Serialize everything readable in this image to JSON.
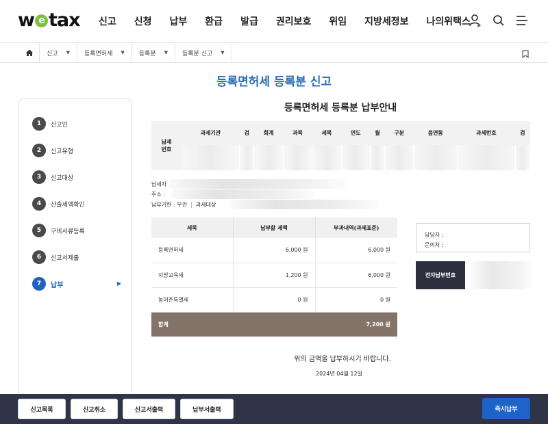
{
  "header": {
    "logo_left": "w",
    "logo_e": "e",
    "logo_right": "tax",
    "nav": [
      "신고",
      "신청",
      "납부",
      "환급",
      "발급",
      "권리보호",
      "위임",
      "지방세정보",
      "나의위택스"
    ],
    "icons": [
      "user-icon",
      "search-icon",
      "menu-icon"
    ],
    "my_label": "MY"
  },
  "breadcrumb": {
    "items": [
      "신고",
      "등록면허세",
      "등록분",
      "등록분 신고"
    ]
  },
  "page_title": "등록면허세 등록분 신고",
  "steps": [
    {
      "num": "1",
      "label": "신고인"
    },
    {
      "num": "2",
      "label": "신고유형"
    },
    {
      "num": "3",
      "label": "신고대상"
    },
    {
      "num": "4",
      "label": "산출세액확인"
    },
    {
      "num": "5",
      "label": "구비서류등록"
    },
    {
      "num": "6",
      "label": "신고서제출"
    },
    {
      "num": "7",
      "label": "납부"
    }
  ],
  "doc_title": "등록면허세 등록분 납부안내",
  "number_table": {
    "lead_label_1": "납세",
    "lead_label_2": "번호",
    "headers": [
      "과세기관",
      "검",
      "회계",
      "과목",
      "세목",
      "연도",
      "월",
      "구분",
      "읍면동",
      "과세번호",
      "검"
    ]
  },
  "info": {
    "taxpayer_label": "납세자",
    "address_label": "주소 :",
    "deadline_label": "납부기한 : 무관",
    "target_label": "과세대상"
  },
  "tax_table": {
    "headers": [
      "세목",
      "납부할 세액",
      "부과내역(과세표준)"
    ],
    "rows": [
      {
        "name": "등록면허세",
        "amount": "6,000 원",
        "base": "6,000 원"
      },
      {
        "name": "지방교육세",
        "amount": "1,200 원",
        "base": "6,000 원"
      },
      {
        "name": "농어촌특별세",
        "amount": "0 원",
        "base": "0 원"
      }
    ],
    "total_label": "합계",
    "total_amount": "7,200 원"
  },
  "contact": {
    "manager_label": "담당자 :",
    "inquiry_label": "문의처 :"
  },
  "epay_label": "전자납부번호",
  "notice": "위의 금액을 납부하시기 바랍니다.",
  "date": "2024년 04월 12일",
  "bottom_buttons": [
    "신고목록",
    "신고취소",
    "신고서출력",
    "납부서출력"
  ],
  "pay_button": "즉시납부",
  "colors": {
    "accent": "#1e63c4",
    "title_blue": "#2a6db5",
    "total_row": "#847369",
    "bottom_bar": "#303447",
    "epay_label_bg": "#2e2f3e",
    "logo_green": "#7cc242"
  }
}
